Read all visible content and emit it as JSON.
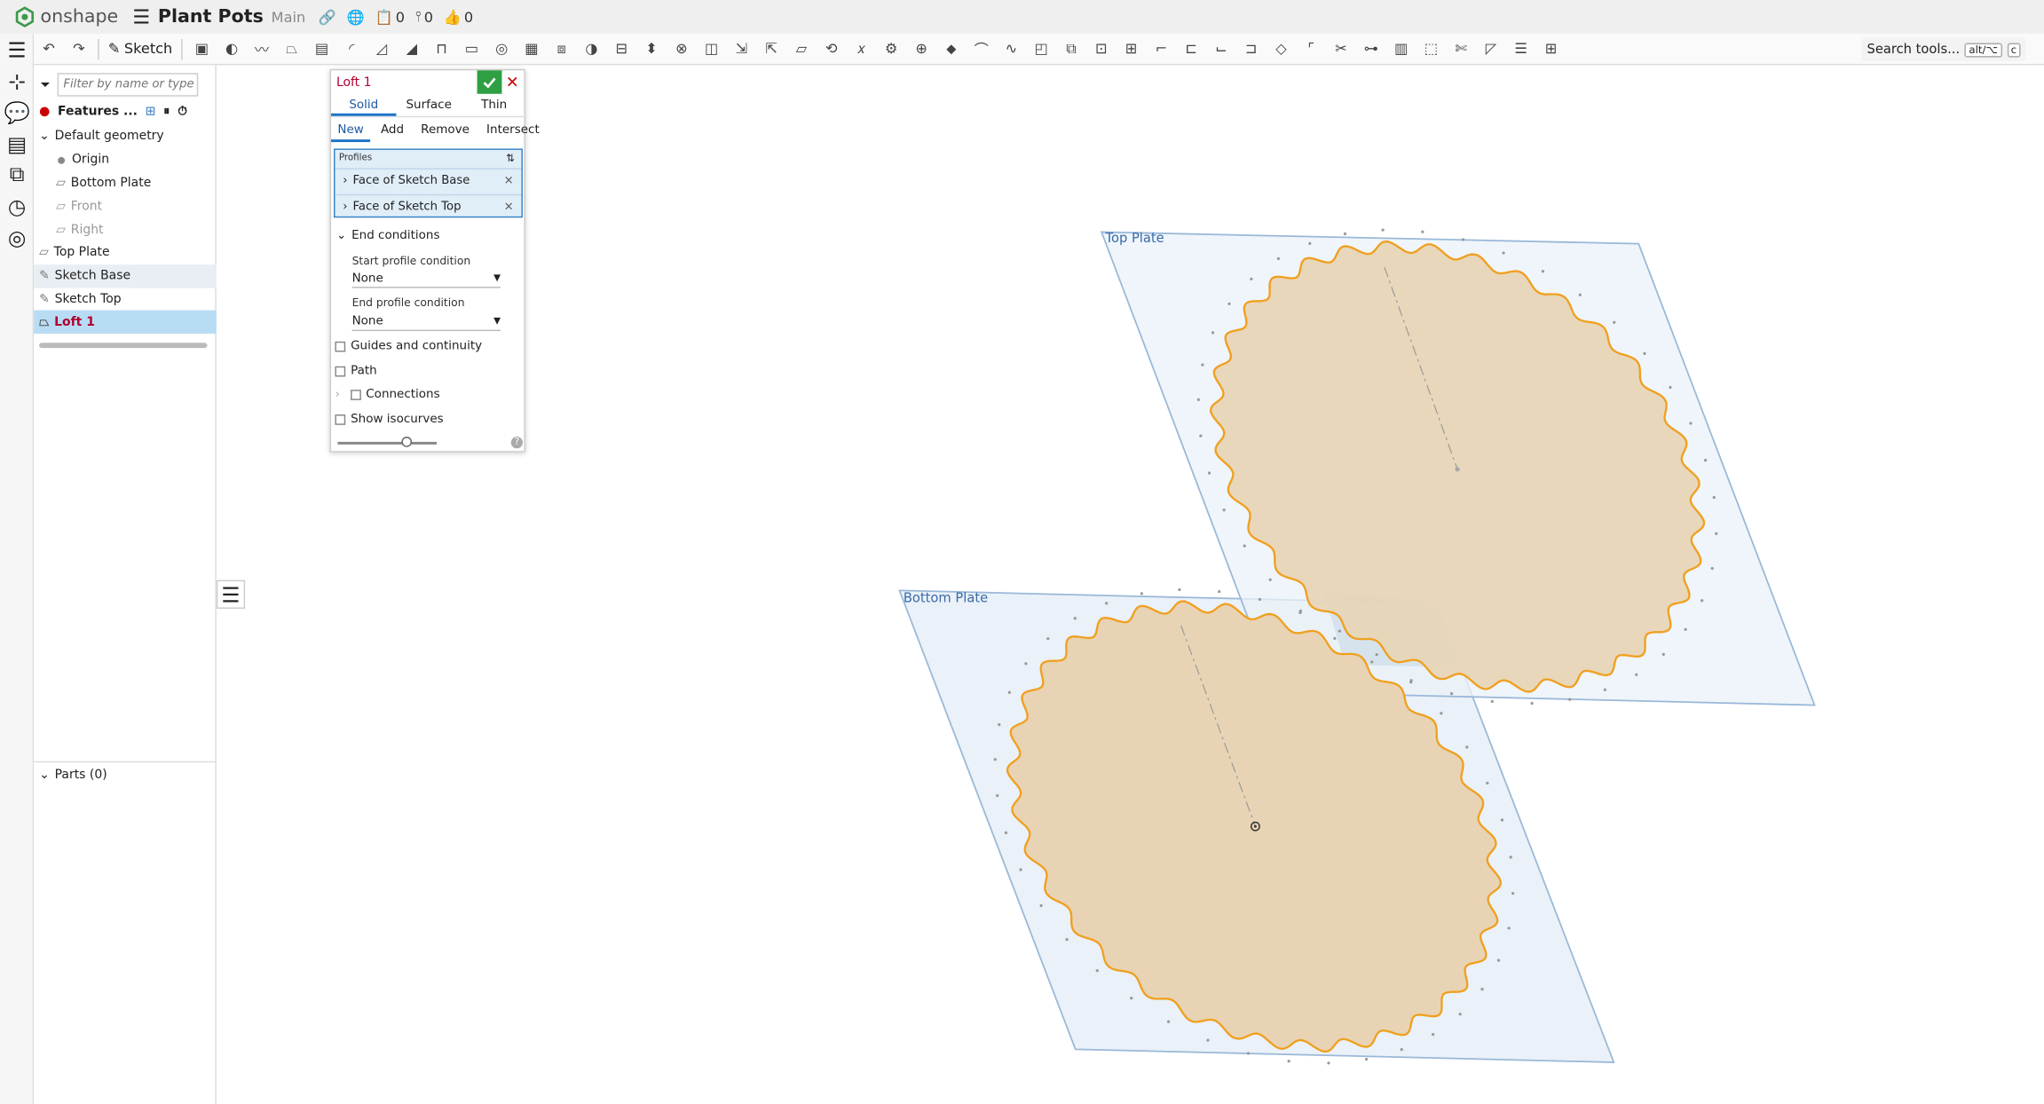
{
  "app": {
    "brand": "onshape",
    "doc_title": "Plant Pots",
    "branch": "Main",
    "counts": {
      "docs": "0",
      "versions": "0",
      "likes": "0"
    }
  },
  "toolbar": {
    "sketch_label": "Sketch",
    "search_label": "Search tools...",
    "shortcut1": "alt/⌥",
    "shortcut2": "c"
  },
  "feature_panel": {
    "filter_placeholder": "Filter by name or type",
    "features_label": "Features ...",
    "tree": [
      {
        "label": "Default geometry"
      },
      {
        "label": "Origin"
      },
      {
        "label": "Bottom Plate"
      },
      {
        "label": "Front"
      },
      {
        "label": "Right"
      },
      {
        "label": "Top Plate"
      },
      {
        "label": "Sketch Base"
      },
      {
        "label": "Sketch Top"
      },
      {
        "label": "Loft 1"
      }
    ],
    "parts_label": "Parts (0)"
  },
  "dialog": {
    "title": "Loft 1",
    "type_tabs": [
      "Solid",
      "Surface",
      "Thin"
    ],
    "op_tabs": [
      "New",
      "Add",
      "Remove",
      "Intersect"
    ],
    "profiles_label": "Profiles",
    "profiles": [
      "Face of Sketch Base",
      "Face of Sketch Top"
    ],
    "end_conditions_label": "End conditions",
    "start_label": "Start profile condition",
    "start_value": "None",
    "end_label": "End profile condition",
    "end_value": "None",
    "guides_label": "Guides and continuity",
    "path_label": "Path",
    "connections_label": "Connections",
    "isocurves_label": "Show isocurves",
    "slider_fraction": 0.7
  },
  "viewport": {
    "top_plate_label": "Top Plate",
    "bottom_plate_label": "Bottom Plate",
    "colors": {
      "plane_fill": "#eaf1f8",
      "plane_stroke": "#9ab8d8",
      "face_fill": "#e8d4b4",
      "edge": "#f0a020"
    }
  }
}
